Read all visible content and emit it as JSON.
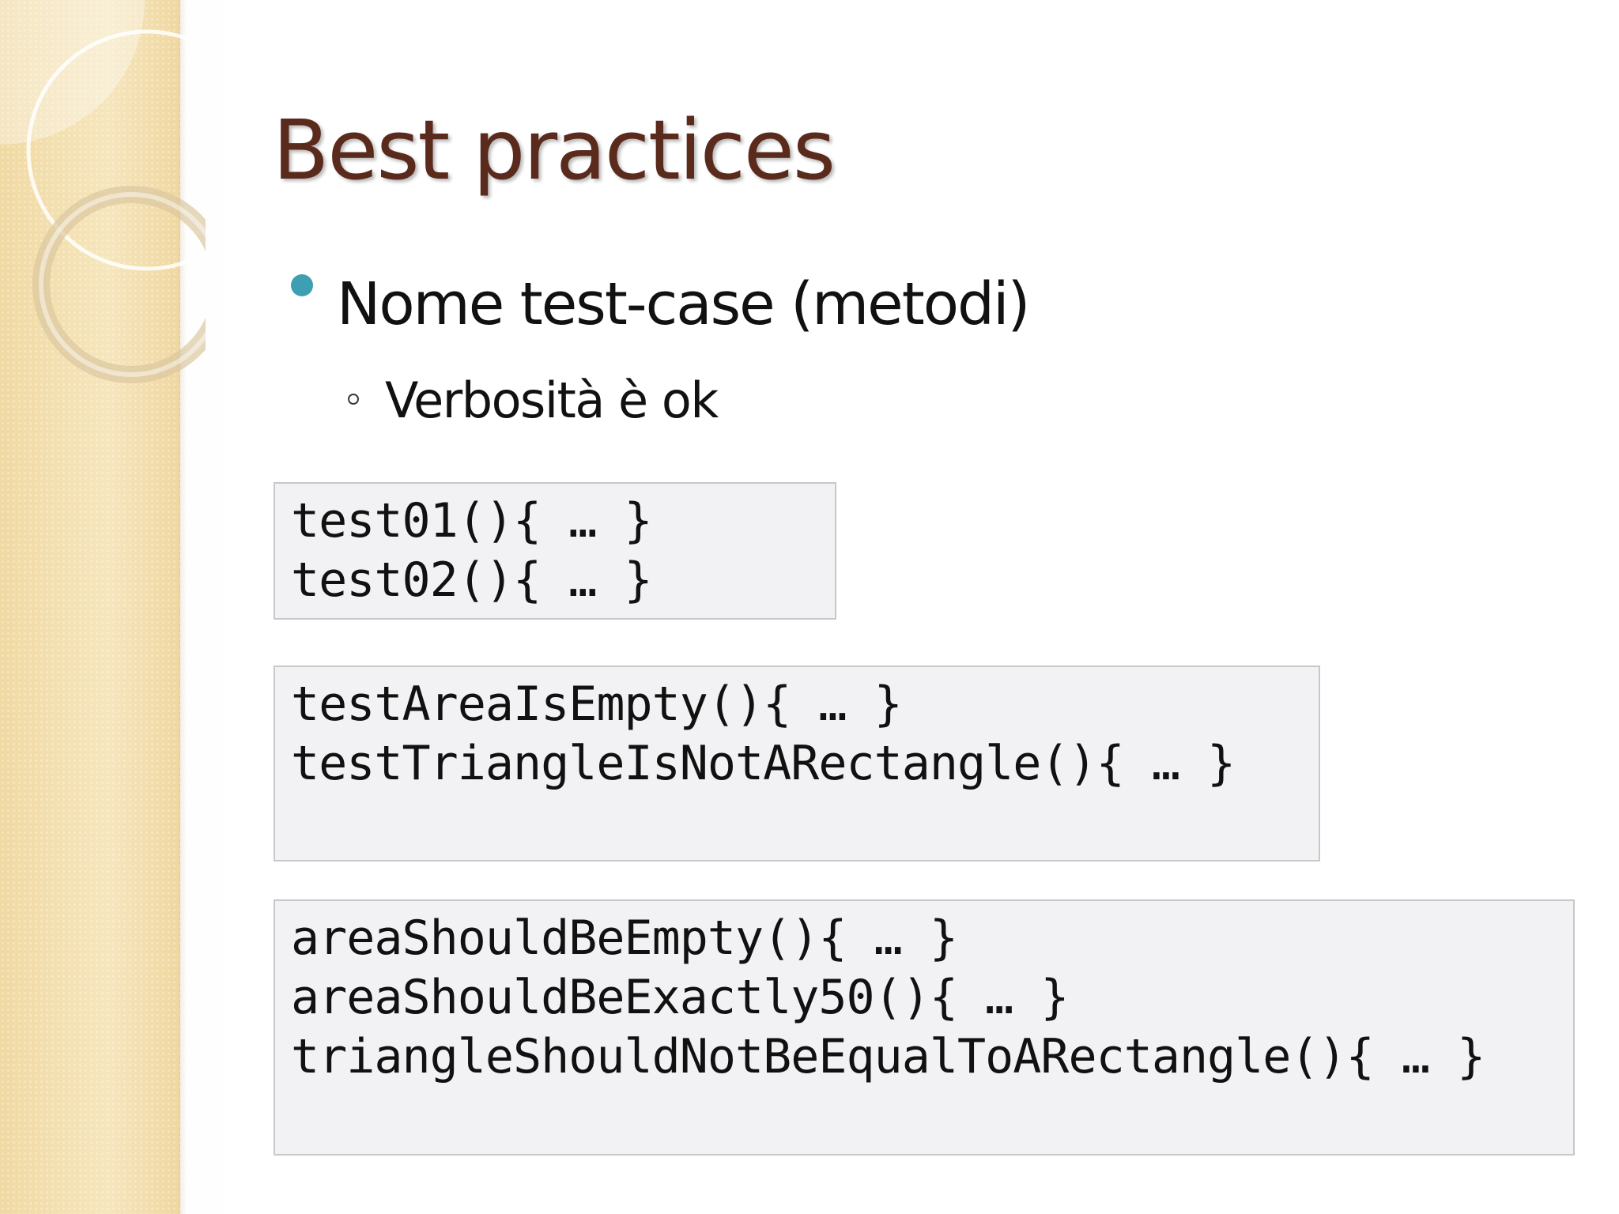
{
  "slide": {
    "title": "Best practices",
    "bullets": [
      {
        "level": 1,
        "text": "Nome test-case (metodi)"
      },
      {
        "level": 2,
        "text": "Verbosità è ok"
      }
    ],
    "code_blocks": [
      {
        "lines": [
          "test01(){ … }",
          "test02(){ … }"
        ]
      },
      {
        "lines": [
          "testAreaIsEmpty(){ … }",
          "testTriangleIsNotARectangle(){ … }"
        ]
      },
      {
        "lines": [
          "areaShouldBeEmpty(){ … }",
          "areaShouldBeExactly50(){ … }",
          "triangleShouldNotBeEqualToARectangle(){ … }"
        ]
      }
    ]
  },
  "colors": {
    "title": "#5a2a1d",
    "bullet": "#3e9fb3",
    "sidebar": "#f3dfac",
    "code_box_bg": "#f2f2f4",
    "code_box_border": "#c8c8ca"
  }
}
